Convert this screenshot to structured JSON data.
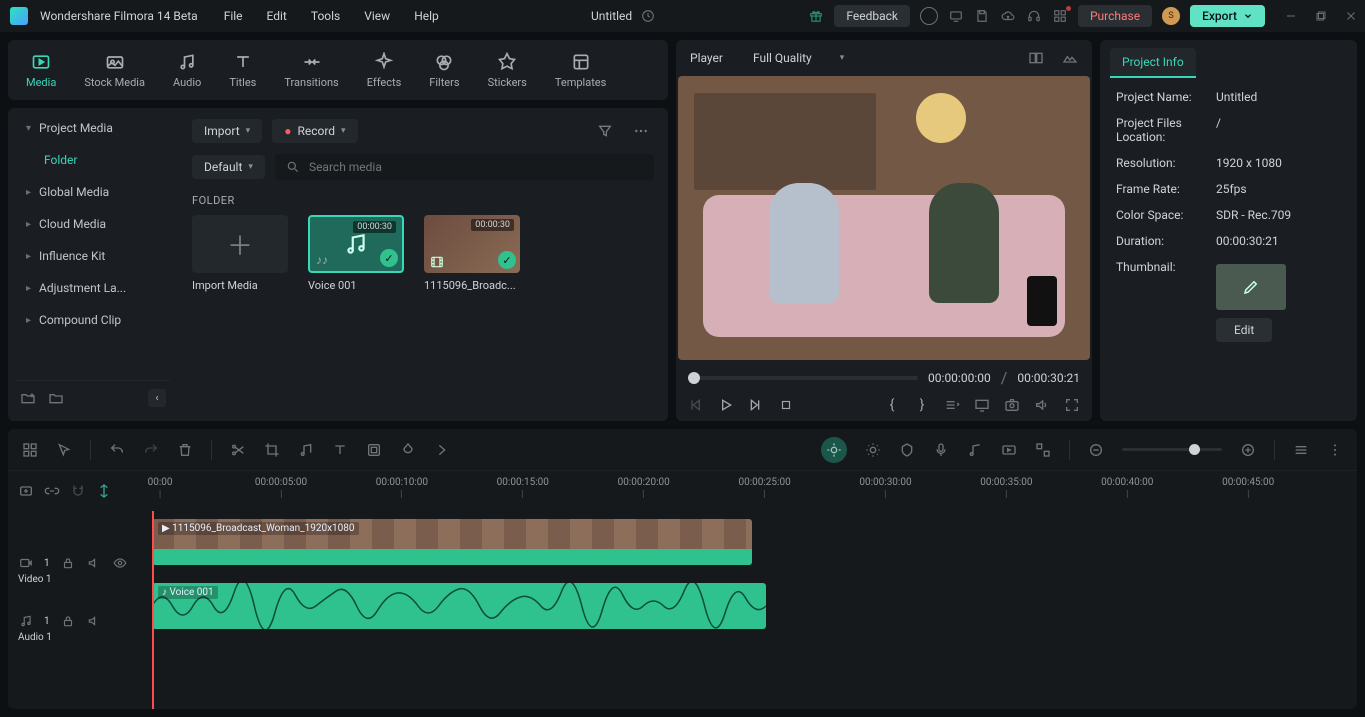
{
  "app": {
    "name": "Wondershare Filmora 14 Beta",
    "doc_title": "Untitled"
  },
  "menu": {
    "file": "File",
    "edit": "Edit",
    "tools": "Tools",
    "view": "View",
    "help": "Help"
  },
  "topright": {
    "feedback": "Feedback",
    "purchase": "Purchase",
    "export": "Export"
  },
  "categories": {
    "media": "Media",
    "stock": "Stock Media",
    "audio": "Audio",
    "titles": "Titles",
    "transitions": "Transitions",
    "effects": "Effects",
    "filters": "Filters",
    "stickers": "Stickers",
    "templates": "Templates"
  },
  "sidebar": {
    "project_media": "Project Media",
    "folder": "Folder",
    "global": "Global Media",
    "cloud": "Cloud Media",
    "influence": "Influence Kit",
    "adjustment": "Adjustment La...",
    "compound": "Compound Clip"
  },
  "media": {
    "import": "Import",
    "record": "Record",
    "default": "Default",
    "search_placeholder": "Search media",
    "folder_label": "FOLDER"
  },
  "thumbs": {
    "import": "Import Media",
    "voice": {
      "label": "Voice 001",
      "dur": "00:00:30"
    },
    "video": {
      "label": "1115096_Broadc...",
      "dur": "00:00:30"
    }
  },
  "player": {
    "title": "Player",
    "quality": "Full Quality",
    "current": "00:00:00:00",
    "total": "00:00:30:21"
  },
  "project_info": {
    "tab": "Project Info",
    "name_label": "Project Name:",
    "name": "Untitled",
    "loc_label": "Project Files Location:",
    "loc": "/",
    "res_label": "Resolution:",
    "res": "1920 x 1080",
    "fps_label": "Frame Rate:",
    "fps": "25fps",
    "cs_label": "Color Space:",
    "cs": "SDR - Rec.709",
    "dur_label": "Duration:",
    "dur": "00:00:30:21",
    "thumb_label": "Thumbnail:",
    "edit": "Edit"
  },
  "ruler": {
    "t0": "00:00",
    "t1": "00:00:05:00",
    "t2": "00:00:10:00",
    "t3": "00:00:15:00",
    "t4": "00:00:20:00",
    "t5": "00:00:25:00",
    "t6": "00:00:30:00",
    "t7": "00:00:35:00",
    "t8": "00:00:40:00",
    "t9": "00:00:45:00"
  },
  "tracks": {
    "video1": "Video 1",
    "audio1": "Audio 1",
    "video_clip": "1115096_Broadcast_Woman_1920x1080",
    "audio_clip": "Voice 001"
  }
}
